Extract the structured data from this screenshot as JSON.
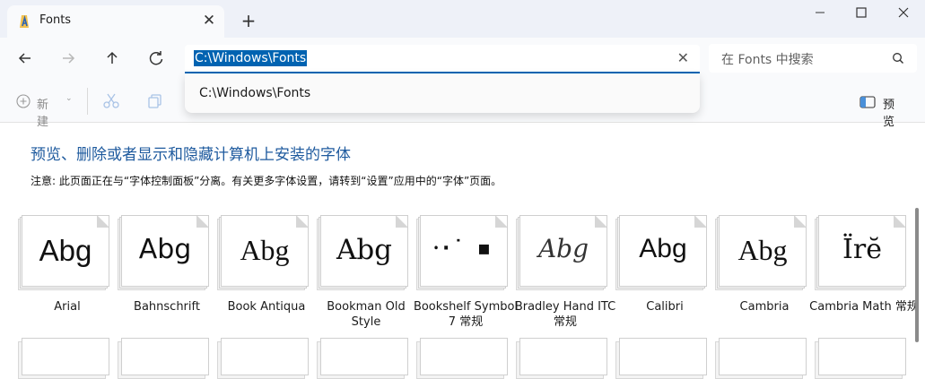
{
  "window": {
    "tab_title": "Fonts",
    "close_tab": "✕",
    "new_tab": "+"
  },
  "address": {
    "path": "C:\\Windows\\Fonts",
    "clear": "✕",
    "suggestion": "C:\\Windows\\Fonts"
  },
  "search": {
    "placeholder": "在 Fonts 中搜索"
  },
  "toolbar": {
    "new_label": "新建",
    "preview_label": "预览"
  },
  "content": {
    "heading": "预览、删除或者显示和隐藏计算机上安装的字体",
    "notice": "注意: 此页面正在与“字体控制面板”分离。有关更多字体设置，请转到“设置”应用中的“字体”页面。"
  },
  "fonts": [
    {
      "name": "Arial",
      "sample": "Abg"
    },
    {
      "name": "Bahnschrift",
      "sample": "Abg"
    },
    {
      "name": "Book Antiqua",
      "sample": "Abg"
    },
    {
      "name": "Bookman Old Style",
      "sample": "Abg"
    },
    {
      "name": "Bookshelf Symbol 7 常规",
      "sample": "⸱·˙ ▪"
    },
    {
      "name": "Bradley Hand ITC 常规",
      "sample": "Abg"
    },
    {
      "name": "Calibri",
      "sample": "Abg"
    },
    {
      "name": "Cambria",
      "sample": "Abg"
    },
    {
      "name": "Cambria Math 常规",
      "sample": "Ïrĕ"
    }
  ]
}
